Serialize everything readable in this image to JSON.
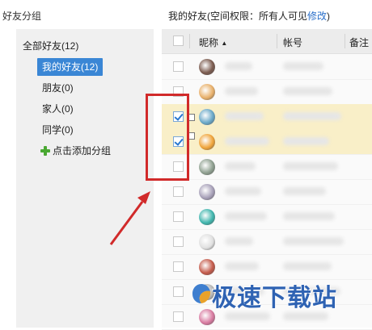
{
  "left_panel": {
    "title": "好友分组",
    "all_friends": "全部好友(12)",
    "groups": [
      {
        "label": "我的好友(12)",
        "active": true
      },
      {
        "label": "朋友(0)",
        "active": false
      },
      {
        "label": "家人(0)",
        "active": false
      },
      {
        "label": "同学(0)",
        "active": false
      }
    ],
    "add_group": "点击添加分组"
  },
  "right_panel": {
    "title_prefix": "我的好友(空间权限：所有人可见",
    "title_link": "修改",
    "title_suffix": ")",
    "columns": [
      "昵称",
      "帐号",
      "备注"
    ],
    "sort_indicator": "▲",
    "rows": [
      {
        "checked": false,
        "avatar_color": "#7a5a4e"
      },
      {
        "checked": false,
        "avatar_color": "#e8b06a"
      },
      {
        "checked": true,
        "avatar_color": "#6aa8c8"
      },
      {
        "checked": true,
        "avatar_color": "#f0a43a"
      },
      {
        "checked": false,
        "avatar_color": "#8fa090"
      },
      {
        "checked": false,
        "avatar_color": "#a7a0b8"
      },
      {
        "checked": false,
        "avatar_color": "#3fb5ad"
      },
      {
        "checked": false,
        "avatar_color": "#e0e0e0"
      },
      {
        "checked": false,
        "avatar_color": "#c45a4a"
      },
      {
        "checked": false,
        "avatar_color": "#b8b8b8"
      },
      {
        "checked": false,
        "avatar_color": "#d87aa0"
      }
    ]
  },
  "watermark": "极速下载站",
  "colors": {
    "accent": "#3a86d5",
    "link": "#2a6fc9",
    "selected_row": "#f9efc8",
    "annotation": "#d12a2a",
    "plus_icon": "#4aa832"
  }
}
